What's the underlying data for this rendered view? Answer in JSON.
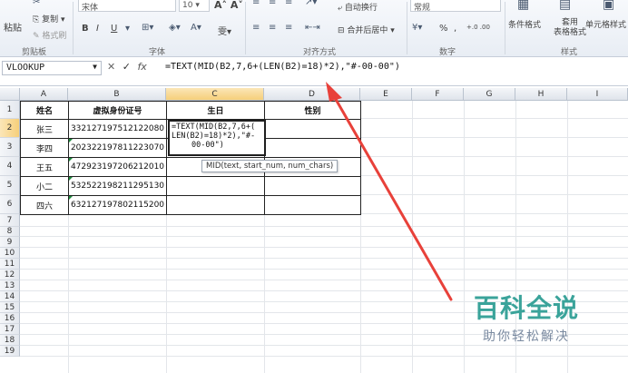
{
  "ribbon": {
    "clipboard": {
      "paste": "粘贴",
      "cut": "剪切",
      "copy": "复制",
      "format_painter": "格式刷",
      "label": "剪贴板"
    },
    "font": {
      "name": "宋体",
      "size": "10",
      "bold": "B",
      "italic": "I",
      "underline": "U",
      "grow": "A",
      "shrink": "A",
      "wen": "雯",
      "label": "字体"
    },
    "alignment": {
      "wrap": "自动换行",
      "merge": "合并后居中",
      "label": "对齐方式"
    },
    "number": {
      "format": "常规",
      "percent": "%",
      "comma": ",",
      "inc_dec": "+.0 .00",
      "dec_dec": ".00 →.0",
      "label": "数字"
    },
    "styles": {
      "conditional": "条件格式",
      "table_format": "套用\n表格格式",
      "cell_styles": "单元格样式",
      "label": "样式"
    }
  },
  "formula_bar": {
    "name_box": "VLOOKUP",
    "cancel": "✕",
    "enter": "✓",
    "fx": "fx",
    "formula": "=TEXT(MID(B2,7,6+(LEN(B2)=18)*2),\"#-00-00\")"
  },
  "grid": {
    "columns": [
      "A",
      "B",
      "C",
      "D",
      "E",
      "F",
      "G",
      "H",
      "I"
    ],
    "rows": [
      "1",
      "2",
      "3",
      "4",
      "5",
      "6",
      "7",
      "8",
      "9",
      "10",
      "11",
      "12",
      "13",
      "14",
      "15",
      "16",
      "17",
      "18",
      "19"
    ],
    "headers": [
      "姓名",
      "虚拟身份证号",
      "生日",
      "性别"
    ],
    "data": [
      {
        "name": "张三",
        "id": "332127197512122080"
      },
      {
        "name": "李四",
        "id": "202322197811223070"
      },
      {
        "name": "王五",
        "id": "472923197206212010"
      },
      {
        "name": "小二",
        "id": "532522198211295130"
      },
      {
        "name": "四六",
        "id": "632127197802115200"
      }
    ],
    "editing_cell": {
      "line1": "=TEXT(MID(B2,7,6+(",
      "line2": "LEN(B2)=18)*2),\"#-",
      "line3": "00-00\")"
    },
    "tooltip": "MID(text, start_num, num_chars)"
  },
  "watermark": {
    "title": "百科全说",
    "subtitle": "助你轻松解决"
  }
}
